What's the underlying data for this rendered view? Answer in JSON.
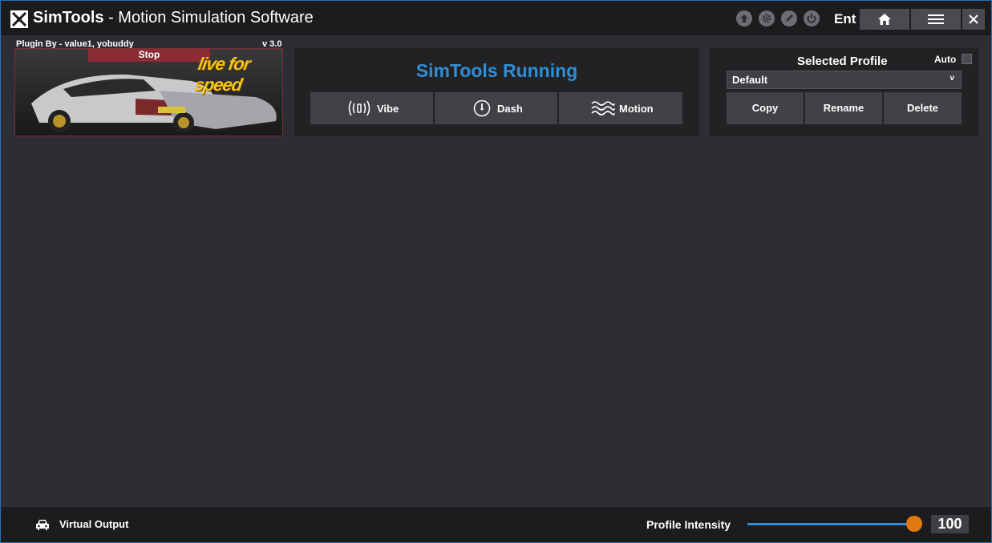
{
  "title_bar": {
    "app_name_bold": "SimTools",
    "app_name_rest": " - Motion Simulation Software",
    "ent_label": "Ent",
    "icons": [
      "upload-icon",
      "settings-icon",
      "edit-icon",
      "power-icon",
      "home-icon",
      "menu-icon",
      "close-icon"
    ]
  },
  "plugin": {
    "author": "Plugin By - value1, yobuddy",
    "version": "v 3.0",
    "stop_label": "Stop",
    "logo_text": "live for speed"
  },
  "running": {
    "status": "SimTools Running",
    "buttons": [
      "Vibe",
      "Dash",
      "Motion"
    ]
  },
  "profile": {
    "title": "Selected Profile",
    "auto_label": "Auto",
    "auto_checked": false,
    "selected": "Default",
    "chevron": "v",
    "buttons": [
      "Copy",
      "Rename",
      "Delete"
    ]
  },
  "bottom": {
    "virtual_output": "Virtual Output",
    "intensity_label": "Profile Intensity",
    "intensity_value": "100",
    "intensity_fraction": 1.0
  },
  "colors": {
    "accent_blue": "#2f8fd6",
    "slider_thumb": "#e07a10",
    "stop_red": "#8b2c35"
  }
}
